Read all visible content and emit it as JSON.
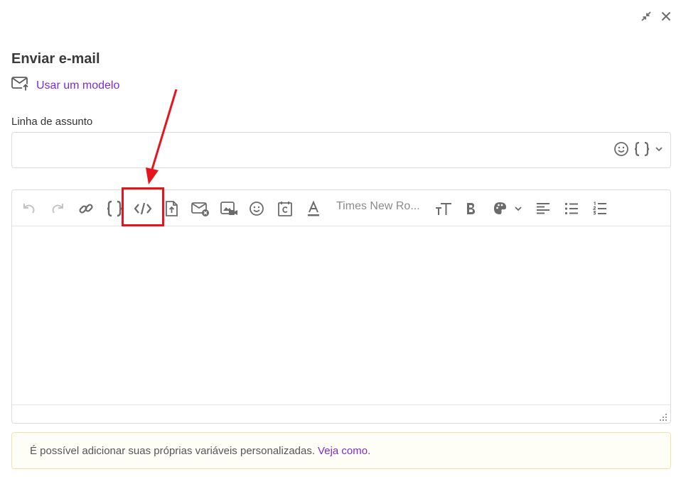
{
  "dialog": {
    "title": "Enviar e-mail",
    "template_link": "Usar um modelo",
    "subject_label": "Linha de assunto",
    "subject_value": "",
    "subject_placeholder": ""
  },
  "editor": {
    "font_family_value": "Times New Ro...",
    "body_text": "",
    "toolbar_icons": [
      "undo-icon",
      "redo-icon",
      "link-icon",
      "variable-icon",
      "html-source-icon",
      "attachment-icon",
      "unsubscribe-icon",
      "video-icon",
      "emoji-icon",
      "calendar-icon",
      "font-color-icon",
      "font-size-icon",
      "bold-icon",
      "palette-icon",
      "align-left-icon",
      "bullet-list-icon",
      "numbered-list-icon"
    ]
  },
  "notice": {
    "text": "É possível adicionar suas próprias variáveis personalizadas.",
    "link": "Veja como."
  },
  "colors": {
    "accent": "#7b2bd8",
    "icon": "#7a7a7a",
    "disabled_icon": "#c4c4c4",
    "highlight": "#e8141b",
    "notice_border": "#f1e3a6"
  }
}
